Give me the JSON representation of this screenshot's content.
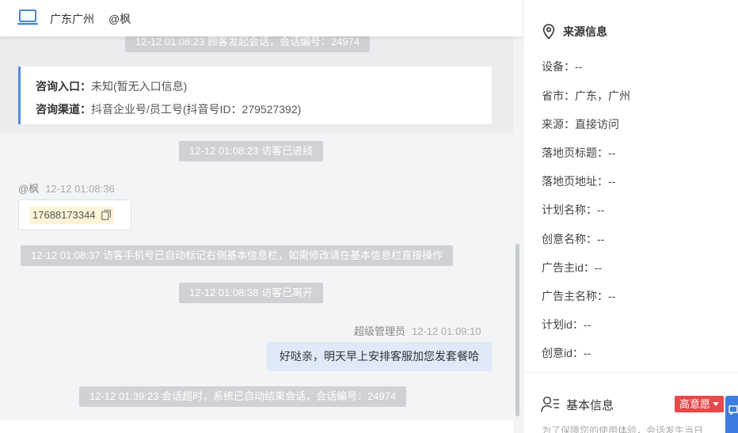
{
  "header": {
    "location": "广东广州",
    "user": "@枫"
  },
  "chat": {
    "system_start": "12-12 01:08:23 顾客发起会话，会话编号：24974",
    "info_card": {
      "entry_label": "咨询入口：",
      "entry_value": "未知(暂无入口信息)",
      "channel_label": "咨询渠道：",
      "channel_value": "抖音企业号/员工号(抖音号ID：279527392)"
    },
    "system_entered": "12-12 01:08:23 访客已进线",
    "visitor_msg": {
      "name": "@枫",
      "time": "12-12 01:08:36",
      "phone": "17688173344"
    },
    "system_phone_note": "12-12 01:08:37 访客手机号已自动标记右侧基本信息栏，如需修改请在基本信息栏直接操作",
    "system_left": "12-12 01:08:38 访客已离开",
    "agent_msg": {
      "name": "超级管理员",
      "time": "12-12 01:09:10",
      "text": "好哒亲，明天早上安排客服加您发套餐哈"
    },
    "system_timeout": "12-12 01:39:23 会话超时，系统已自动结束会话，会话编号：24974"
  },
  "side": {
    "source_title": "来源信息",
    "rows": [
      "设备：--",
      "省市：广东，广州",
      "来源：直接访问",
      "落地页标题：--",
      "落地页地址：--",
      "计划名称：--",
      "创意名称：--",
      "广告主id：--",
      "广告主名称：--",
      "计划id：--",
      "创意id：--"
    ],
    "basic_title": "基本信息",
    "intent_badge": "高意愿",
    "note": "为了保障您的使用体验，会话发生当日"
  },
  "colors": {
    "accent": "#4c8ee8",
    "badge_red": "#e84848",
    "system_pill": "#cfd1d4",
    "agent_bubble": "#dfe9f8"
  },
  "icons": {
    "header": "laptop-icon",
    "source": "location-pin-icon",
    "basic": "person-list-icon",
    "phone": "copy-icon"
  }
}
